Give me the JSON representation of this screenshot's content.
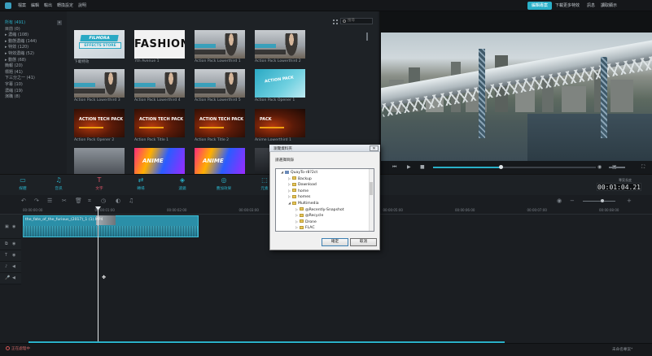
{
  "menubar": {
    "items": [
      "檔案",
      "編輯",
      "輸出",
      "轉換設定",
      "說明"
    ],
    "pills": [
      "編輯專案",
      "下載更多特效",
      "訊息",
      "讀取顯示"
    ]
  },
  "categories": [
    {
      "label": "所有 (491)",
      "selected": true
    },
    {
      "label": "目前 (0)"
    },
    {
      "label": "▸ 濃縮 (108)"
    },
    {
      "label": "▸ 動態濃縮 (144)"
    },
    {
      "label": "▸ 特效 (120)"
    },
    {
      "label": "▸ 特效濃縮 (52)"
    },
    {
      "label": "▸ 動態 (68)"
    },
    {
      "label": "簡報 (20)"
    },
    {
      "label": "標題 (41)"
    },
    {
      "label": "下三分之一 (41)"
    },
    {
      "label": "字幕 (10)"
    },
    {
      "label": "濃縮 (19)"
    },
    {
      "label": "演職 (8)"
    }
  ],
  "search": {
    "placeholder": "搜尋"
  },
  "thumbnails": [
    {
      "label": "下載特效",
      "style": "t-filmora",
      "text1": "FILMORA",
      "text2": "EFFECTS STORE"
    },
    {
      "label": "7th Avenue 1",
      "style": "t-fashion",
      "text1": "FASHION"
    },
    {
      "label": "Action Pack Lowerthird 1",
      "style": "t-photo"
    },
    {
      "label": "Action Pack Lowerthird 2",
      "style": "t-photo"
    },
    {
      "label": "Action Pack Lowerthird 3",
      "style": "t-photo"
    },
    {
      "label": "Action Pack Lowerthird 4",
      "style": "t-photo"
    },
    {
      "label": "Action Pack Lowerthird 5",
      "style": "t-photo"
    },
    {
      "label": "Action Pack Opener 1",
      "style": "t-opener",
      "text1": "ACTION PACK"
    },
    {
      "label": "Action Pack Opener 2",
      "style": "t-action",
      "text1": "ACTION TECH PACK"
    },
    {
      "label": "Action Pack Title 1",
      "style": "t-action",
      "text1": "ACTION TECH PACK"
    },
    {
      "label": "Action Pack Title 2",
      "style": "t-action",
      "text1": "ACTION TECH PACK"
    },
    {
      "label": "Anime Lowerthird 1",
      "style": "t-action",
      "text1": "PACK"
    },
    {
      "label": "",
      "style": "t-grey"
    },
    {
      "label": "",
      "style": "t-color",
      "text1": "ANIME"
    },
    {
      "label": "",
      "style": "t-color",
      "text1": "ANIME"
    },
    {
      "label": "",
      "style": "t-dark"
    }
  ],
  "tabs": [
    {
      "label": "媒體"
    },
    {
      "label": "音訊"
    },
    {
      "label": "文字",
      "red": true
    },
    {
      "label": "轉場"
    },
    {
      "label": "濾鏡"
    },
    {
      "label": "疊加效果"
    },
    {
      "label": "元素"
    }
  ],
  "timecode": {
    "label": "專案長度",
    "value": "00:01:04.21"
  },
  "ruler": [
    "00:00:00:00",
    "00:00:01:00",
    "00:00:02:00",
    "00:00:03:00",
    "00:00:04:00",
    "00:00:05:00",
    "00:00:06:00",
    "00:00:07:00",
    "00:00:08:00"
  ],
  "clip": {
    "title": "the_fate_of_the_furious_(2017)_1 (1).MP4"
  },
  "dialog": {
    "title": "瀏覽資料夾",
    "prompt": "請選擇目錄",
    "tree": [
      {
        "label": "QuayTo-r8?2ct",
        "indent": 0,
        "type": "pc"
      },
      {
        "label": "Backup",
        "indent": 1
      },
      {
        "label": "Download",
        "indent": 1
      },
      {
        "label": "home",
        "indent": 1
      },
      {
        "label": "homes",
        "indent": 1
      },
      {
        "label": "Multimedia",
        "indent": 1
      },
      {
        "label": "@Recently-Snapshot",
        "indent": 2
      },
      {
        "label": "@Recycle",
        "indent": 2
      },
      {
        "label": "Drone",
        "indent": 2
      },
      {
        "label": "FLAC",
        "indent": 2
      }
    ],
    "ok": "確定",
    "cancel": "取消"
  },
  "status": {
    "left": "正在處理中",
    "right": "未命名專案*"
  },
  "colors": {
    "accent": "#2ab0c8",
    "text_tab_red": "#e0566a"
  }
}
